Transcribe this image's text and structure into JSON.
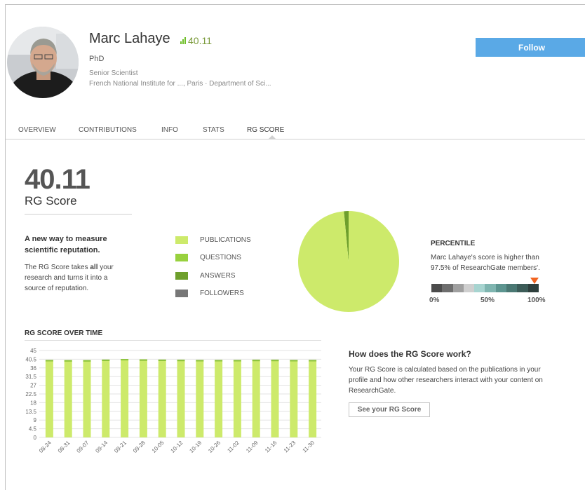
{
  "profile": {
    "name": "Marc Lahaye",
    "rg_score_badge": "40.11",
    "degree": "PhD",
    "position": "Senior Scientist",
    "institution": "French National Institute for ..., Paris · Department of Sci..."
  },
  "follow_label": "Follow",
  "tabs": [
    {
      "label": "OVERVIEW"
    },
    {
      "label": "CONTRIBUTIONS"
    },
    {
      "label": "INFO"
    },
    {
      "label": "STATS"
    },
    {
      "label": "RG SCORE",
      "active": true
    }
  ],
  "score": {
    "value": "40.11",
    "label": "RG Score",
    "tagline": "A new way to measure scientific reputation.",
    "desc_pre": "The RG Score takes ",
    "desc_bold": "all",
    "desc_post": " your research and turns it into a source of reputation."
  },
  "breakdown": {
    "legend": [
      {
        "label": "PUBLICATIONS",
        "color": "#cdea6b"
      },
      {
        "label": "QUESTIONS",
        "color": "#98d13e"
      },
      {
        "label": "ANSWERS",
        "color": "#6e9f2c"
      },
      {
        "label": "FOLLOWERS",
        "color": "#777777"
      }
    ],
    "pie_fractions": [
      0.985,
      0.0,
      0.015,
      0.0
    ]
  },
  "percentile": {
    "title": "PERCENTILE",
    "text": "Marc Lahaye's score is higher than 97.5% of ResearchGate members'.",
    "value": 97.5,
    "scale_colors": [
      "#4c4c4c",
      "#6e6e6e",
      "#a0a0a0",
      "#cfcfcf",
      "#a7d4d0",
      "#7fb5b0",
      "#5d9590",
      "#4a7873",
      "#3c5c58",
      "#2e3f3d"
    ],
    "ticks": [
      "0%",
      "50%",
      "100%"
    ],
    "marker_color": "#f26522"
  },
  "chart_data": {
    "type": "bar",
    "title": "RG SCORE OVER TIME",
    "categories": [
      "08-24",
      "08-31",
      "09-07",
      "09-14",
      "09-21",
      "09-28",
      "10-05",
      "10-12",
      "10-19",
      "10-26",
      "11-02",
      "11-09",
      "11-16",
      "11-23",
      "11-30"
    ],
    "values": [
      40.1,
      40.0,
      40.0,
      40.3,
      40.6,
      40.4,
      40.3,
      40.2,
      40.1,
      40.1,
      40.1,
      40.2,
      40.2,
      40.1,
      40.11
    ],
    "ylim": [
      0,
      45
    ],
    "yticks": [
      "45",
      "40.5",
      "36",
      "31.5",
      "27",
      "22.5",
      "18",
      "13.5",
      "9",
      "4.5",
      "0"
    ],
    "grid": true,
    "bar_color": "#cdea6b",
    "cap_color": "#8ac23a"
  },
  "how": {
    "title": "How does the RG Score work?",
    "text": "Your RG Score is calculated based on the publications in your profile and how other researchers interact with your content on ResearchGate.",
    "button": "See your RG Score"
  }
}
